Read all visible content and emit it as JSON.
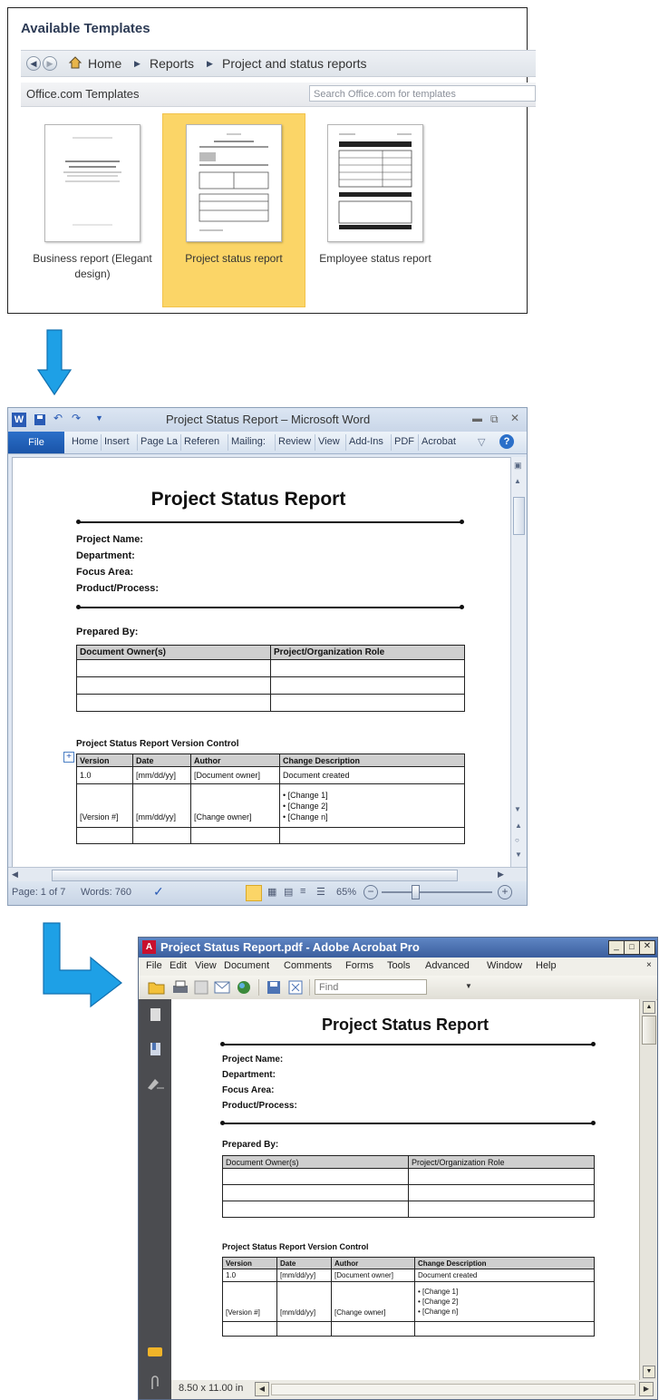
{
  "templates_panel": {
    "title": "Available Templates",
    "breadcrumb": [
      "Home",
      "Reports",
      "Project and status reports"
    ],
    "section_label": "Office.com Templates",
    "search_placeholder": "Search Office.com for templates",
    "templates": [
      {
        "label_line1": "Business report (Elegant",
        "label_line2": "design)",
        "selected": false
      },
      {
        "label_line1": "Project status report",
        "label_line2": "",
        "selected": true
      },
      {
        "label_line1": "Employee status report",
        "label_line2": "",
        "selected": false
      }
    ]
  },
  "word_window": {
    "title": "Project Status Report – Microsoft Word",
    "file_tab": "File",
    "ribbon_tabs": [
      "Home",
      "Insert",
      "Page La",
      "Referen",
      "Mailing:",
      "Review",
      "View",
      "Add-Ins",
      "PDF",
      "Acrobat"
    ],
    "status": {
      "page": "Page: 1 of 7",
      "words": "Words: 760",
      "zoom": "65%",
      "zoom_level": 0.65
    }
  },
  "acrobat_window": {
    "title": "Project Status Report.pdf - Adobe Acrobat Pro",
    "menus": [
      "File",
      "Edit",
      "View",
      "Document",
      "Comments",
      "Forms",
      "Tools",
      "Advanced",
      "Window",
      "Help"
    ],
    "find_placeholder": "Find",
    "page_size": "8.50 x 11.00 in"
  },
  "report": {
    "title": "Project Status Report",
    "fields": [
      "Project Name:",
      "Department:",
      "Focus Area:",
      "Product/Process:"
    ],
    "prepared_by": "Prepared By:",
    "owner_table": {
      "headers": [
        "Document Owner(s)",
        "Project/Organization Role"
      ],
      "blank_rows": 3
    },
    "version_title": "Project Status Report Version Control",
    "version_table": {
      "headers": [
        "Version",
        "Date",
        "Author",
        "Change Description"
      ],
      "rows": [
        {
          "version": "1.0",
          "date": "[mm/dd/yy]",
          "author": "[Document owner]",
          "change": [
            "Document created"
          ]
        },
        {
          "version": "[Version #]",
          "date": "[mm/dd/yy]",
          "author": "[Change owner]",
          "change": [
            "• [Change 1]",
            "• [Change 2]",
            "• [Change n]"
          ]
        }
      ]
    }
  },
  "colors": {
    "arrow": "#1ea0e6",
    "selected_tile": "#fbd567",
    "word_file_tab": "#1a54a8",
    "acrobat_titlebar": "#3a5e9d"
  }
}
